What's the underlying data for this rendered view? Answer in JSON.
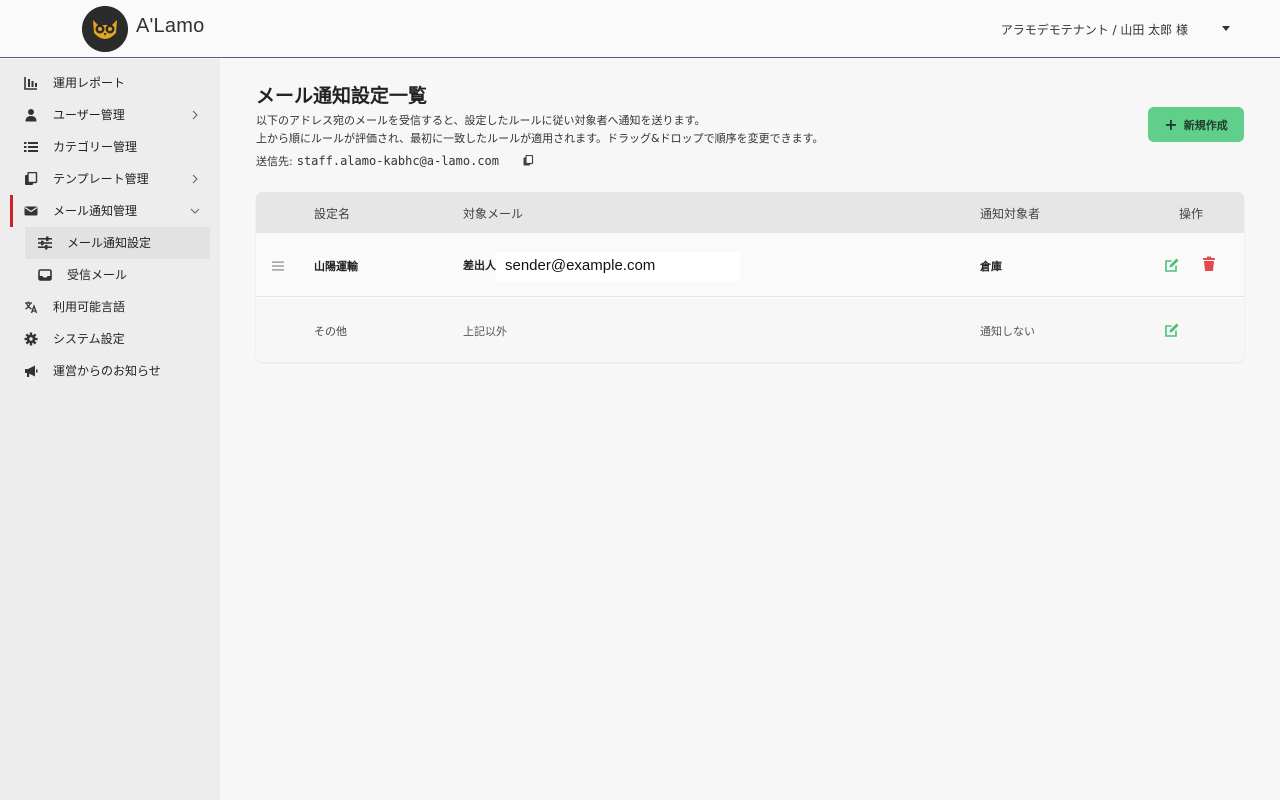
{
  "header": {
    "brand": "A'Lamo",
    "user": "アラモデモテナント / 山田 太郎 様"
  },
  "sidebar": {
    "items": [
      {
        "label": "運用レポート"
      },
      {
        "label": "ユーザー管理"
      },
      {
        "label": "カテゴリー管理"
      },
      {
        "label": "テンプレート管理"
      },
      {
        "label": "メール通知管理"
      },
      {
        "label": "メール通知設定"
      },
      {
        "label": "受信メール"
      },
      {
        "label": "利用可能言語"
      },
      {
        "label": "システム設定"
      },
      {
        "label": "運営からのお知らせ"
      }
    ]
  },
  "main": {
    "title": "メール通知設定一覧",
    "description_1": "以下のアドレス宛のメールを受信すると、設定したルールに従い対象者へ通知を送ります。",
    "description_2": "上から順にルールが評価され、最初に一致したルールが適用されます。ドラッグ&ドロップで順序を変更できます。",
    "sender_label": "送信先:",
    "sender_address": "staff.alamo-kabhc@a-lamo.com",
    "new_button_label": "新規作成"
  },
  "table": {
    "headers": [
      "設定名",
      "対象メール",
      "通知対象者",
      "操作"
    ],
    "rows": [
      {
        "name": "山陽運輸",
        "target_prefix": "差出人",
        "target_email": "sender@example.com",
        "recipient": "倉庫"
      },
      {
        "name": "その他",
        "target_prefix": "上記以外",
        "recipient": "通知しない"
      }
    ]
  },
  "colors": {
    "accent_green": "#5fcf8a",
    "edit_green": "#4cc07a",
    "delete_red": "#e5484d",
    "active_bar_red": "#d0202a"
  }
}
